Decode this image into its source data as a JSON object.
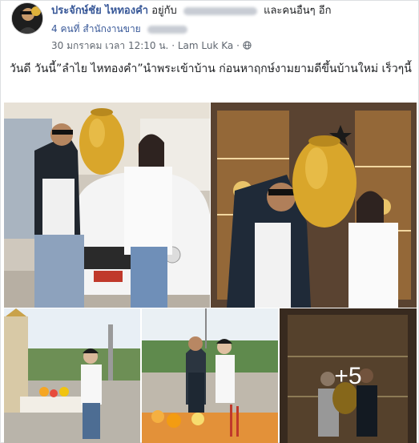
{
  "post": {
    "author": "ประจักษ์ชัย ไหทองคำ",
    "with_text": "อยู่กับ",
    "others_text": "และคนอื่นๆ อีก",
    "subline": "4 คนที่ สำนักงานขาย",
    "date": "30 มกราคม เวลา 12:10 น.",
    "separator": "·",
    "location": "Lam Luk Ka",
    "privacy_icon": "globe-icon",
    "text": "วันดี วันนี้”ลำไย ไหทองคำ”นำพระเข้าบ้าน ก่อนหาฤกษ์งามยามดีขึ้นบ้านใหม่ เร็วๆนี้"
  },
  "photos": {
    "more_count": "+5"
  },
  "colors": {
    "link": "#385898",
    "meta": "#606770",
    "gold": "#d9a62b"
  }
}
